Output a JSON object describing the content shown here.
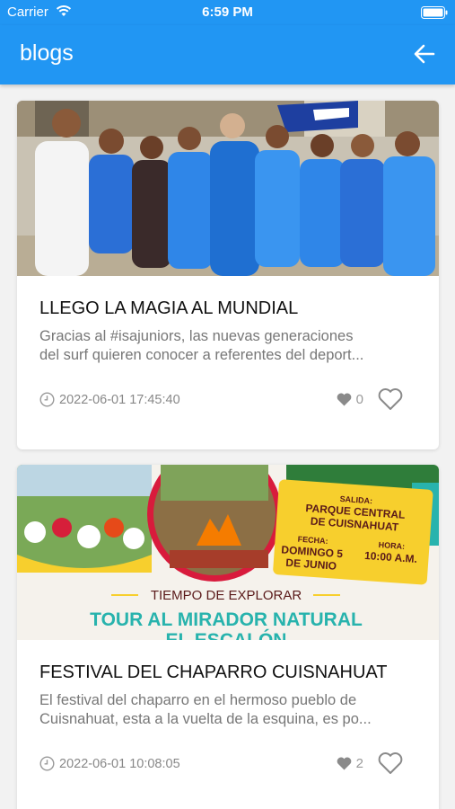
{
  "status_bar": {
    "carrier": "Carrier",
    "time": "6:59 PM"
  },
  "header": {
    "title": "blogs"
  },
  "posts": [
    {
      "title": "LLEGO LA MAGIA AL MUNDIAL",
      "excerpt_line1": "Gracias al #isajuniors, las nuevas generaciones",
      "excerpt_line2": "del surf quieren conocer a referentes del deport...",
      "date": "2022-06-01 17:45:40",
      "likes": "0"
    },
    {
      "title": "FESTIVAL DEL CHAPARRO CUISNAHUAT",
      "excerpt_line1": "El festival del chaparro en el hermoso pueblo de",
      "excerpt_line2": "Cuisnahuat, esta a la vuelta de la esquina, es po...",
      "date": "2022-06-01 10:08:05",
      "likes": "2",
      "poster": {
        "salida_label": "SALIDA:",
        "salida_line1": "PARQUE CENTRAL",
        "salida_line2": "DE CUISNAHUAT",
        "fecha_label": "FECHA:",
        "fecha_line1": "DOMINGO 5",
        "fecha_line2": "DE JUNIO",
        "hora_label": "HORA:",
        "hora_value": "10:00 A.M.",
        "tagline": "TIEMPO DE EXPLORAR",
        "headline_line1": "TOUR AL MIRADOR NATURAL",
        "headline_line2": "EL ESCALÓN"
      }
    }
  ],
  "colors": {
    "app_bar": "#2196f3",
    "poster_yellow": "#f7cf2d",
    "poster_teal": "#28b3ad",
    "poster_red": "#d81b3c"
  }
}
